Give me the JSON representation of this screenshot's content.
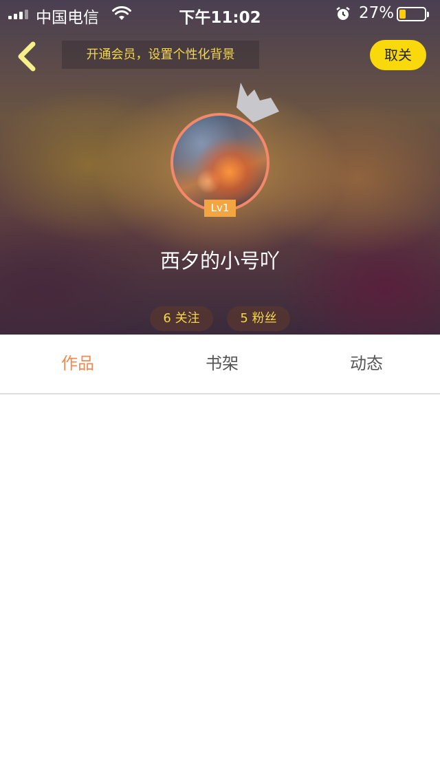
{
  "status_bar": {
    "carrier": "中国电信",
    "time": "下午11:02",
    "battery_percent": "27%",
    "battery_level": 0.27,
    "icons": [
      "signal-icon",
      "wifi-icon",
      "alarm-icon",
      "battery-icon"
    ]
  },
  "top_bar": {
    "back_icon": "chevron-left-icon",
    "vip_banner": "开通会员，设置个性化背景",
    "follow_label": "取关"
  },
  "profile": {
    "badge_icon": "crown-icon",
    "level": "Lv1",
    "username": "西夕的小号吖"
  },
  "stats": {
    "following": "6 关注",
    "fans": "5 粉丝"
  },
  "tabs": [
    {
      "label": "作品",
      "active": true
    },
    {
      "label": "书架",
      "active": false
    },
    {
      "label": "动态",
      "active": false
    }
  ],
  "colors": {
    "accent_yellow": "#f9d90c",
    "banner_text": "#f3d64a",
    "active_tab": "#f28a52",
    "level_badge": "#f2a541",
    "avatar_ring": "#f2896a"
  }
}
